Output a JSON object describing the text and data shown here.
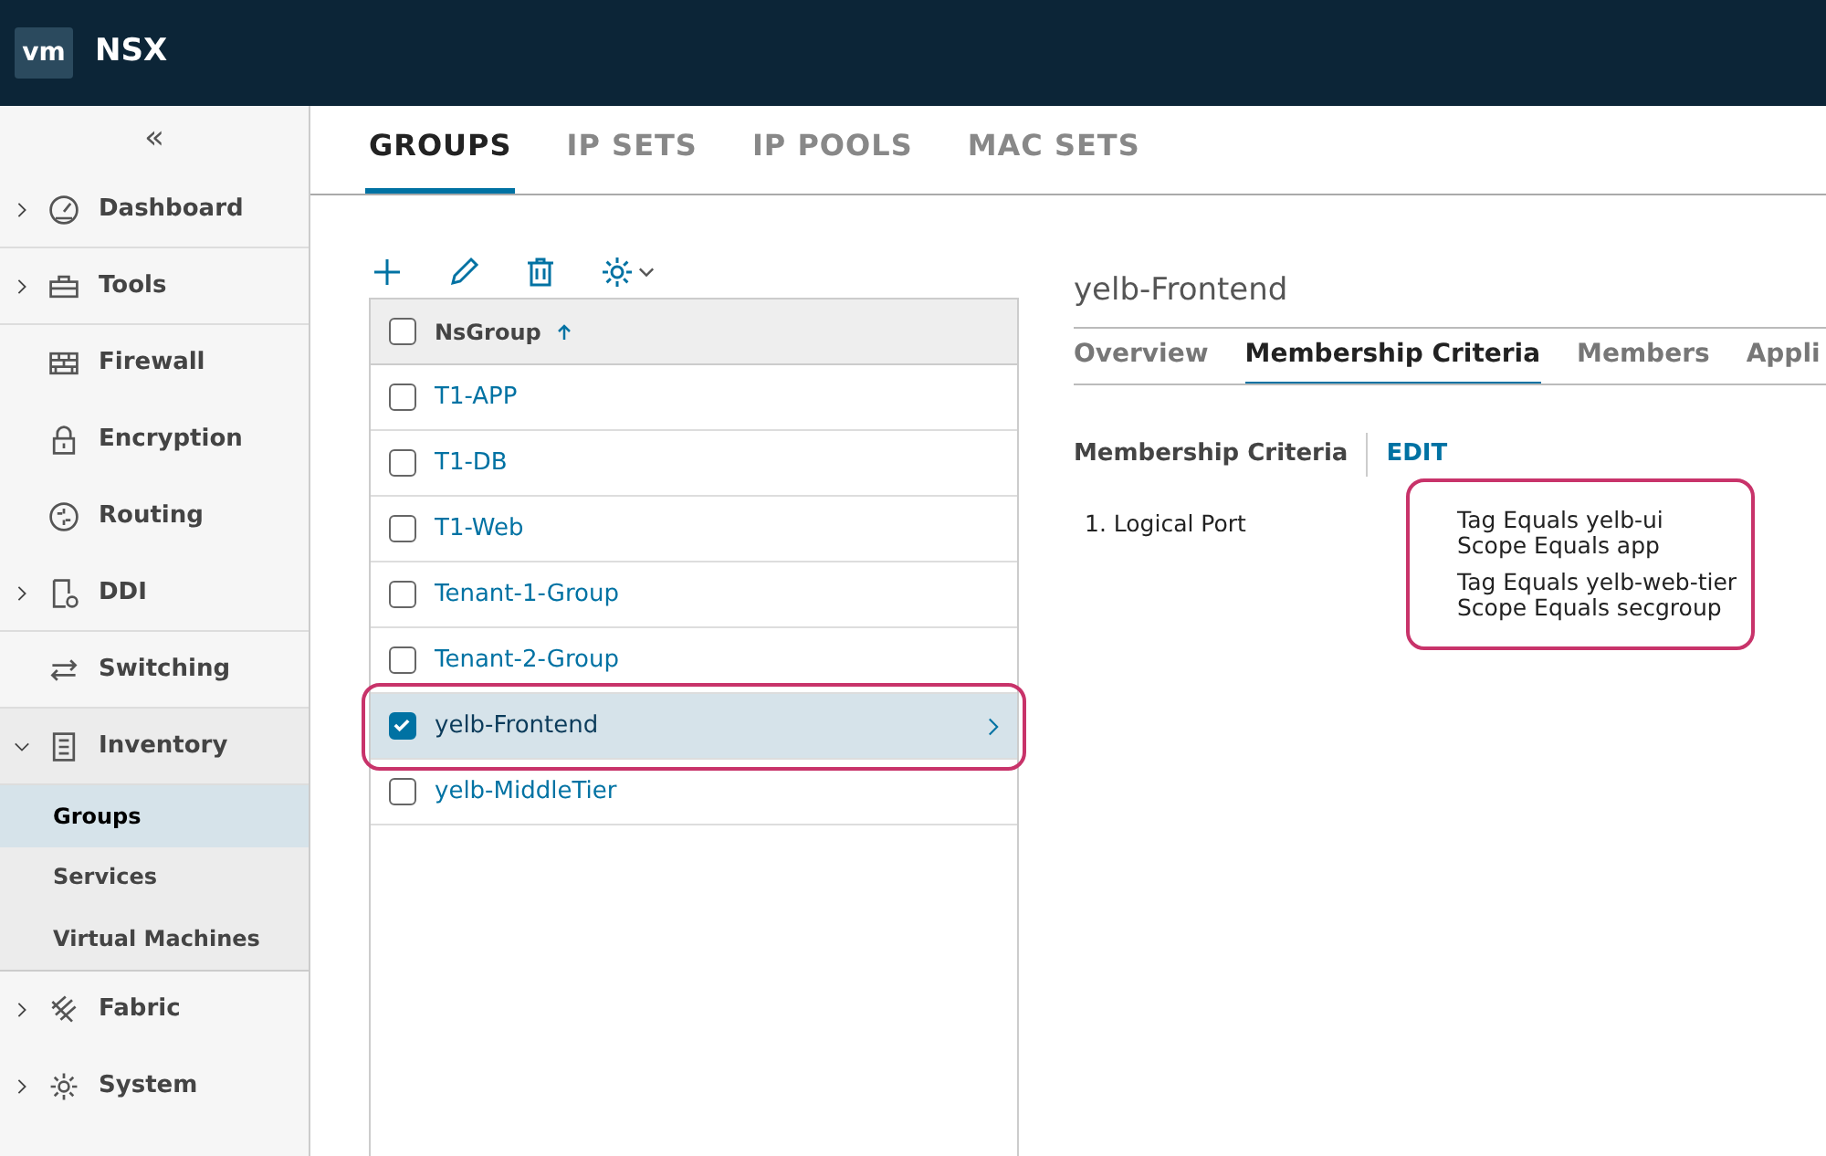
{
  "header": {
    "logo": "vm",
    "title": "NSX"
  },
  "sidebar": {
    "collapse_glyph": "«",
    "items": [
      {
        "label": "Dashboard",
        "kind": "collapsible",
        "expanded": false,
        "selected": false,
        "divider_after": true
      },
      {
        "label": "Tools",
        "kind": "collapsible",
        "expanded": false,
        "selected": false,
        "divider_after": true
      },
      {
        "label": "Firewall",
        "kind": "plain",
        "selected": false,
        "divider_after": false
      },
      {
        "label": "Encryption",
        "kind": "plain",
        "selected": false,
        "divider_after": false
      },
      {
        "label": "Routing",
        "kind": "plain",
        "selected": false,
        "divider_after": false
      },
      {
        "label": "DDI",
        "kind": "collapsible",
        "expanded": false,
        "selected": false,
        "divider_after": true
      },
      {
        "label": "Switching",
        "kind": "plain",
        "selected": false,
        "divider_after": true
      },
      {
        "label": "Inventory",
        "kind": "collapsible",
        "expanded": true,
        "selected": false,
        "divider_after": true,
        "children": [
          {
            "label": "Groups",
            "selected": true
          },
          {
            "label": "Services",
            "selected": false
          },
          {
            "label": "Virtual Machines",
            "selected": false
          }
        ]
      },
      {
        "label": "Fabric",
        "kind": "collapsible",
        "expanded": false,
        "selected": false,
        "divider_after": false
      },
      {
        "label": "System",
        "kind": "collapsible",
        "expanded": false,
        "selected": false,
        "divider_after": false
      }
    ]
  },
  "tabs": [
    {
      "label": "GROUPS",
      "selected": true
    },
    {
      "label": "IP SETS",
      "selected": false
    },
    {
      "label": "IP POOLS",
      "selected": false
    },
    {
      "label": "MAC SETS",
      "selected": false
    }
  ],
  "grid": {
    "column": "NsGroup",
    "all_checked": false,
    "rows": [
      {
        "label": "T1-APP",
        "checked": false,
        "selected": false,
        "highlighted": false
      },
      {
        "label": "T1-DB",
        "checked": false,
        "selected": false,
        "highlighted": false
      },
      {
        "label": "T1-Web",
        "checked": false,
        "selected": false,
        "highlighted": false
      },
      {
        "label": "Tenant-1-Group",
        "checked": false,
        "selected": false,
        "highlighted": false
      },
      {
        "label": "Tenant-2-Group",
        "checked": false,
        "selected": false,
        "highlighted": false
      },
      {
        "label": "yelb-Frontend",
        "checked": true,
        "selected": true,
        "highlighted": true
      },
      {
        "label": "yelb-MiddleTier",
        "checked": false,
        "selected": false,
        "highlighted": false
      }
    ]
  },
  "detail": {
    "title": "yelb-Frontend",
    "tabs": [
      {
        "label": "Overview",
        "selected": false
      },
      {
        "label": "Membership Criteria",
        "selected": true
      },
      {
        "label": "Members",
        "selected": false
      },
      {
        "label": "Appli",
        "selected": false
      }
    ],
    "section_title": "Membership Criteria",
    "edit_link": "EDIT",
    "criteria": [
      {
        "label": "1. Logical Port",
        "highlighted": true,
        "conditions": [
          [
            "Tag Equals yelb-ui",
            "Scope Equals app"
          ],
          [
            "Tag Equals yelb-web-tier",
            "Scope Equals secgroup"
          ]
        ]
      }
    ]
  }
}
